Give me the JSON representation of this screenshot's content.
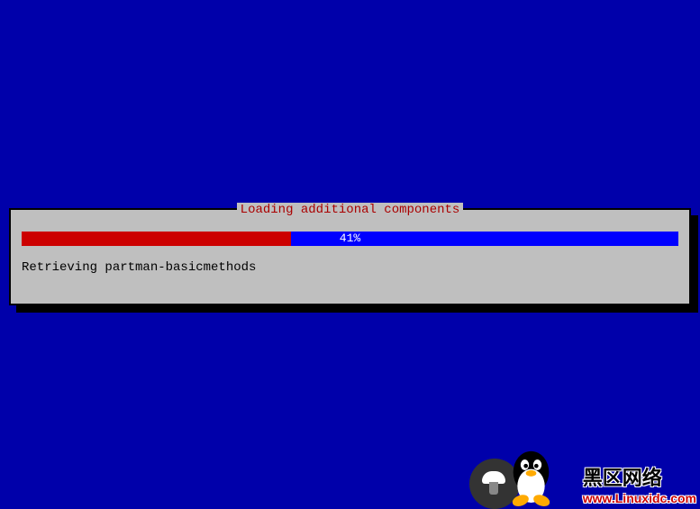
{
  "dialog": {
    "title": "Loading additional components",
    "progress_percent": 41,
    "progress_label": "41%",
    "status_text": "Retrieving partman-basicmethods"
  },
  "watermark": {
    "main_text": "黑区网络",
    "sub_text": "www.Linuxidc.com"
  }
}
